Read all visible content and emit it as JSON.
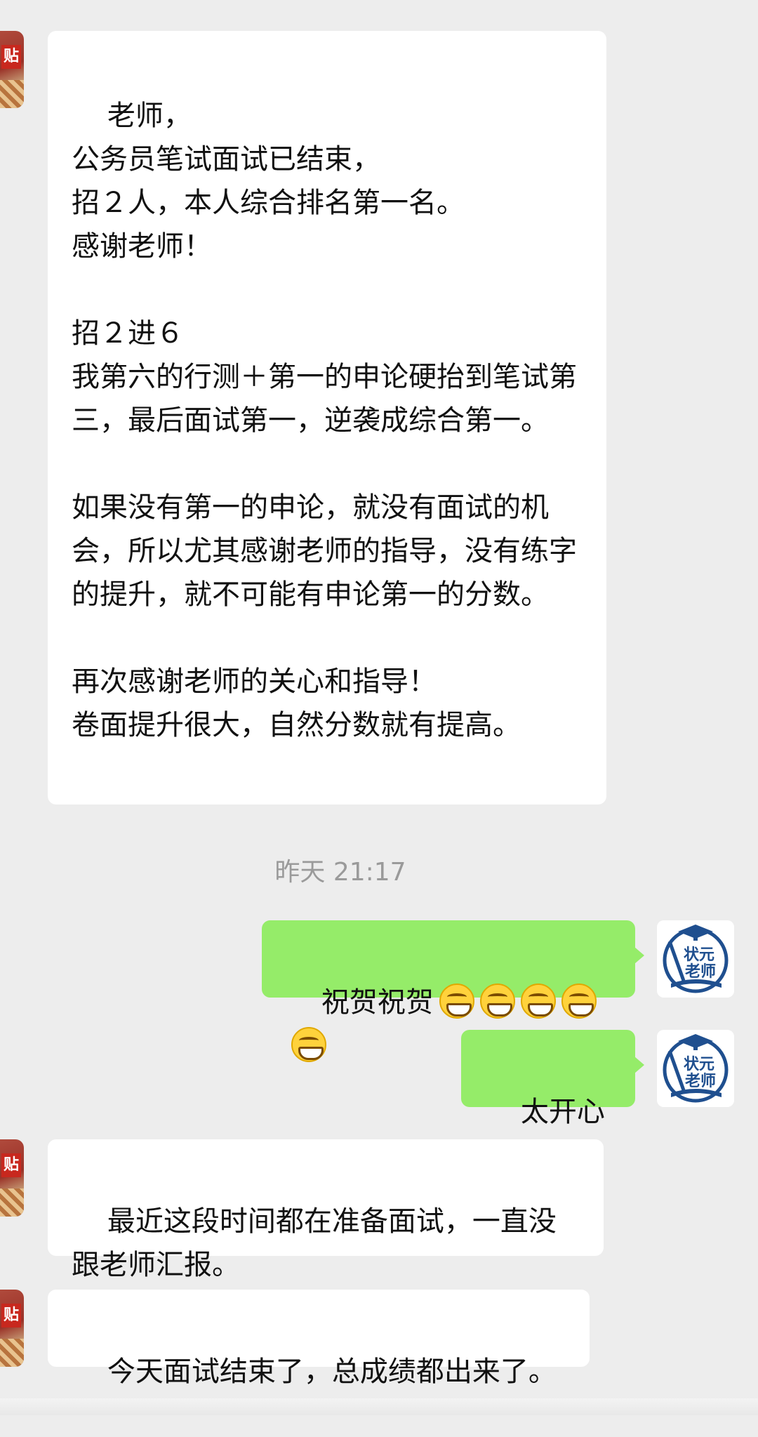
{
  "messages": {
    "m1": {
      "text": "老师，\n公务员笔试面试已结束，\n招２人，本人综合排名第一名。\n感谢老师！\n\n招２进６\n我第六的行测＋第一的申论硬抬到笔试第三，最后面试第一，逆袭成综合第一。\n\n如果没有第一的申论，就没有面试的机会，所以尤其感谢老师的指导，没有练字的提升，就不可能有申论第一的分数。\n\n再次感谢老师的关心和指导！\n卷面提升很大，自然分数就有提高。"
    },
    "timestamp": "昨天 21:17",
    "m2": {
      "text": "祝贺祝贺"
    },
    "m3": {
      "text": "太开心了"
    },
    "m4": {
      "text": "最近这段时间都在准备面试，一直没跟老师汇报。"
    },
    "m5": {
      "text": "今天面试结束了，总成绩都出来了。"
    }
  },
  "avatars": {
    "contact_badge": "贴",
    "teacher_logo_line1": "状元",
    "teacher_logo_line2": "老师"
  },
  "colors": {
    "background": "#ededed",
    "incoming_bubble": "#ffffff",
    "outgoing_bubble": "#95ec69",
    "timestamp": "#9a9a9a"
  },
  "icons": [
    "grinning-face-emoji",
    "contact-avatar",
    "teacher-logo-avatar"
  ]
}
